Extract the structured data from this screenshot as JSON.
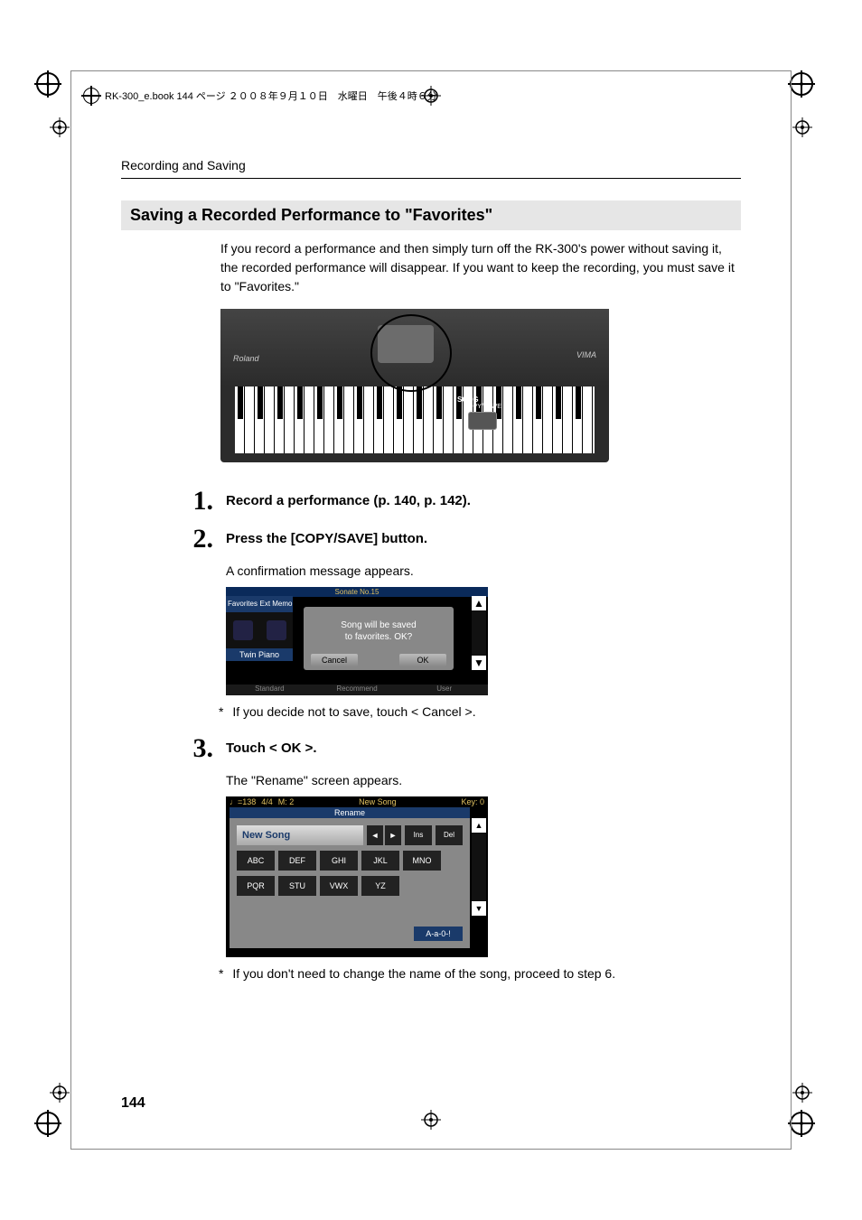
{
  "header": {
    "meta_text": "RK-300_e.book  144 ページ  ２００８年９月１０日　水曜日　午後４時６分"
  },
  "breadcrumb": "Recording and Saving",
  "section_title": "Saving a Recorded Performance to \"Favorites\"",
  "intro": "If you record a performance and then simply turn off the RK-300's power without saving it, the recorded performance will disappear. If you want to keep the recording, you must save it to \"Favorites.\"",
  "keyboard": {
    "brand_left": "Roland",
    "brand_right": "VIMA",
    "callout_label": "SONG",
    "callout_sub": "COPY/\nSAVE"
  },
  "steps": [
    {
      "num": "1.",
      "text": "Record a performance (p. 140, p. 142)."
    },
    {
      "num": "2.",
      "text": "Press the [COPY/SAVE] button."
    },
    {
      "num": "3.",
      "text": "Touch < OK >."
    }
  ],
  "step2_sub": "A confirmation message appears.",
  "step3_sub": "The \"Rename\" screen appears.",
  "note1": "If you decide not to save, touch < Cancel >.",
  "note2": "If you don't need to change the name of the song, proceed to step 6.",
  "screenshot1": {
    "top": "Sonate No.15",
    "tab_left": "Favorites",
    "tab_right": "Ext Memo",
    "twin": "Twin Piano",
    "msg_l1": "Song will be saved",
    "msg_l2": "to favorites. OK?",
    "btn_cancel": "Cancel",
    "btn_ok": "OK",
    "bottom_l": "Standard",
    "bottom_c": "Recommend",
    "bottom_r": "User"
  },
  "screenshot2": {
    "tempo": "♩=138",
    "time": "4/4",
    "measure": "M:  2",
    "center": "New Song",
    "key": "Key: 0",
    "rename": "Rename",
    "input": "New Song",
    "nav_prev": "◄",
    "nav_next": "►",
    "ins": "Ins",
    "del": "Del",
    "keys_row1": [
      "ABC",
      "DEF",
      "GHI",
      "JKL",
      "MNO"
    ],
    "keys_row2": [
      "PQR",
      "STU",
      "VWX",
      "YZ"
    ],
    "mode": "A-a-0-!"
  },
  "page_number": "144",
  "star": "*"
}
